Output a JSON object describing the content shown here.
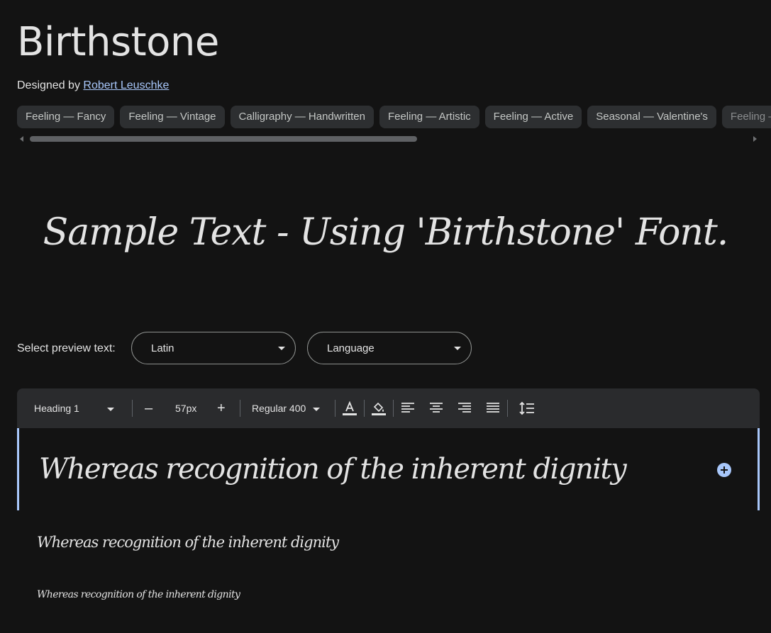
{
  "font": {
    "name": "Birthstone",
    "designed_by_label": "Designed by",
    "designer": "Robert Leuschke"
  },
  "tags": [
    "Feeling — Fancy",
    "Feeling — Vintage",
    "Calligraphy — Handwritten",
    "Feeling — Artistic",
    "Feeling — Active",
    "Seasonal — Valentine's",
    "Feeling — Calm"
  ],
  "sample_text": "Sample Text - Using 'Birthstone' Font.",
  "preview_select": {
    "label": "Select preview text:",
    "script_value": "Latin",
    "language_value": "Language"
  },
  "toolbar": {
    "style_value": "Heading 1",
    "decrease_label": "–",
    "size_value": "57px",
    "increase_label": "+",
    "weight_value": "Regular 400"
  },
  "preview_rows": [
    {
      "text": "Whereas recognition of the inherent dignity"
    },
    {
      "text": "Whereas recognition of the inherent dignity"
    },
    {
      "text": "Whereas recognition of the inherent dignity"
    }
  ],
  "colors": {
    "background": "#131313",
    "link": "#a8c7fa",
    "chip_bg": "#2d2f31",
    "toolbar_bg": "#2a2b2d",
    "accent": "#a8c7fa"
  }
}
